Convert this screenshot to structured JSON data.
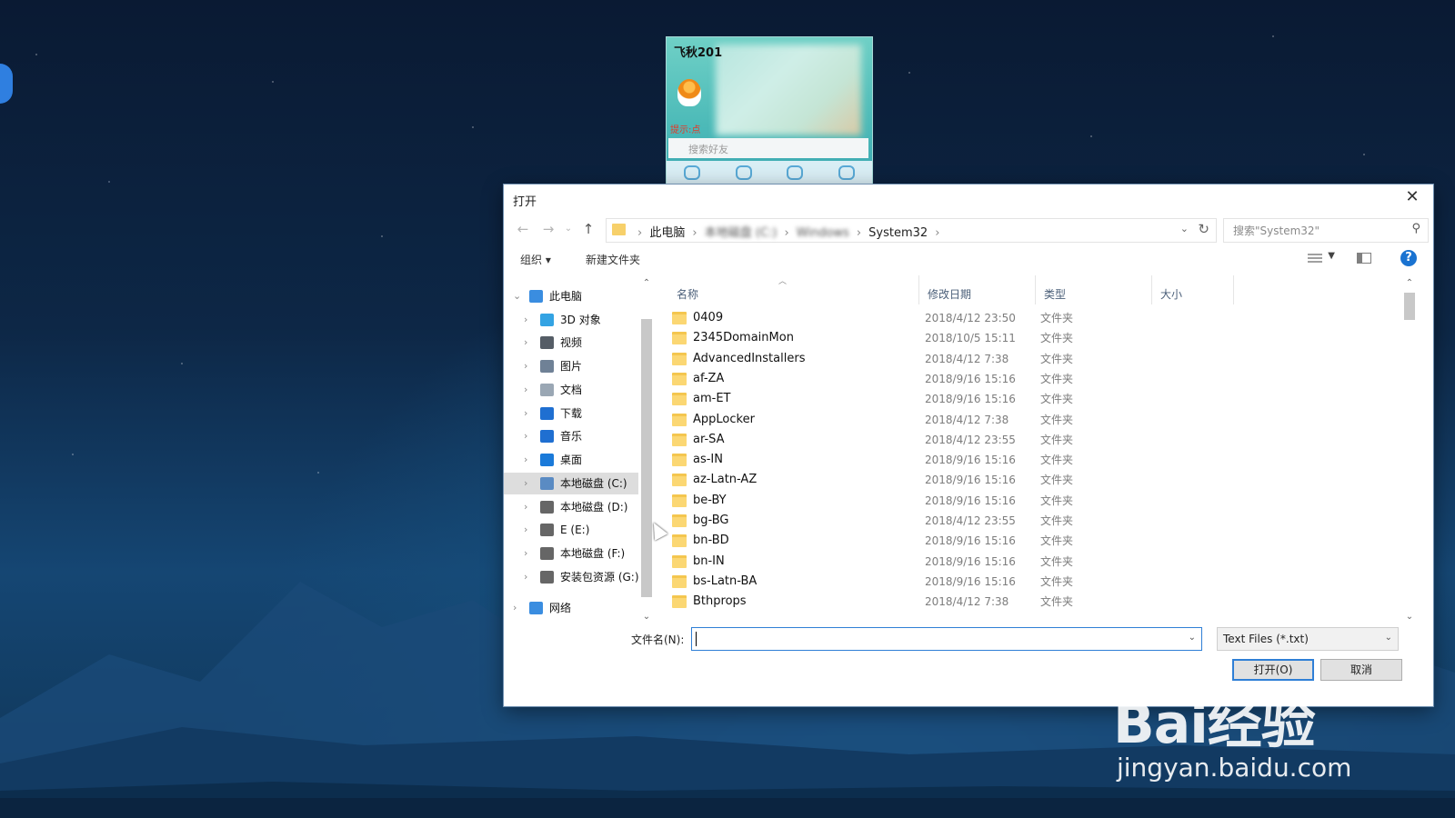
{
  "desktop": {
    "watermark": {
      "brand": "Bai经验",
      "url": "jingyan.baidu.com"
    }
  },
  "qq_panel": {
    "title": "飞秋201",
    "hint": "提示:点",
    "search_placeholder": "搜索好友"
  },
  "dialog": {
    "title": "打开",
    "address": {
      "crumbs": [
        "此电脑",
        "本地磁盘 (C:)",
        "Windows",
        "System32"
      ]
    },
    "search_placeholder": "搜索\"System32\"",
    "toolbar": {
      "organize": "组织 ▾",
      "new_folder": "新建文件夹"
    },
    "tree": [
      {
        "label": "此电脑",
        "icon": "pc-icon",
        "color": "#3a8de0"
      },
      {
        "label": "3D 对象",
        "icon": "cube-icon",
        "color": "#33a3e3"
      },
      {
        "label": "视频",
        "icon": "video-icon",
        "color": "#555d66"
      },
      {
        "label": "图片",
        "icon": "pictures-icon",
        "color": "#6f8196"
      },
      {
        "label": "文档",
        "icon": "document-icon",
        "color": "#9aa7b4"
      },
      {
        "label": "下载",
        "icon": "download-icon",
        "color": "#1f6fd1"
      },
      {
        "label": "音乐",
        "icon": "music-icon",
        "color": "#1f6fd1"
      },
      {
        "label": "桌面",
        "icon": "desktop-icon",
        "color": "#1a7ad9"
      },
      {
        "label": "本地磁盘 (C:)",
        "icon": "drive-c-icon",
        "color": "#5a8bc3",
        "selected": true
      },
      {
        "label": "本地磁盘 (D:)",
        "icon": "drive-icon",
        "color": "#666"
      },
      {
        "label": "E (E:)",
        "icon": "drive-icon",
        "color": "#666"
      },
      {
        "label": "本地磁盘 (F:)",
        "icon": "drive-icon",
        "color": "#666"
      },
      {
        "label": "安装包资源 (G:)",
        "icon": "drive-icon",
        "color": "#666"
      },
      {
        "label": "网络",
        "icon": "network-icon",
        "color": "#3a8de0"
      }
    ],
    "columns": [
      "名称",
      "修改日期",
      "类型",
      "大小"
    ],
    "files": [
      {
        "name": "0409",
        "date": "2018/4/12 23:50",
        "type": "文件夹"
      },
      {
        "name": "2345DomainMon",
        "date": "2018/10/5 15:11",
        "type": "文件夹"
      },
      {
        "name": "AdvancedInstallers",
        "date": "2018/4/12 7:38",
        "type": "文件夹"
      },
      {
        "name": "af-ZA",
        "date": "2018/9/16 15:16",
        "type": "文件夹"
      },
      {
        "name": "am-ET",
        "date": "2018/9/16 15:16",
        "type": "文件夹"
      },
      {
        "name": "AppLocker",
        "date": "2018/4/12 7:38",
        "type": "文件夹"
      },
      {
        "name": "ar-SA",
        "date": "2018/4/12 23:55",
        "type": "文件夹"
      },
      {
        "name": "as-IN",
        "date": "2018/9/16 15:16",
        "type": "文件夹"
      },
      {
        "name": "az-Latn-AZ",
        "date": "2018/9/16 15:16",
        "type": "文件夹"
      },
      {
        "name": "be-BY",
        "date": "2018/9/16 15:16",
        "type": "文件夹"
      },
      {
        "name": "bg-BG",
        "date": "2018/4/12 23:55",
        "type": "文件夹"
      },
      {
        "name": "bn-BD",
        "date": "2018/9/16 15:16",
        "type": "文件夹"
      },
      {
        "name": "bn-IN",
        "date": "2018/9/16 15:16",
        "type": "文件夹"
      },
      {
        "name": "bs-Latn-BA",
        "date": "2018/9/16 15:16",
        "type": "文件夹"
      },
      {
        "name": "Bthprops",
        "date": "2018/4/12 7:38",
        "type": "文件夹"
      }
    ],
    "filename_label": "文件名(N):",
    "filename_value": "",
    "filetype": "Text Files (*.txt)",
    "open_button": "打开(O)",
    "cancel_button": "取消"
  }
}
